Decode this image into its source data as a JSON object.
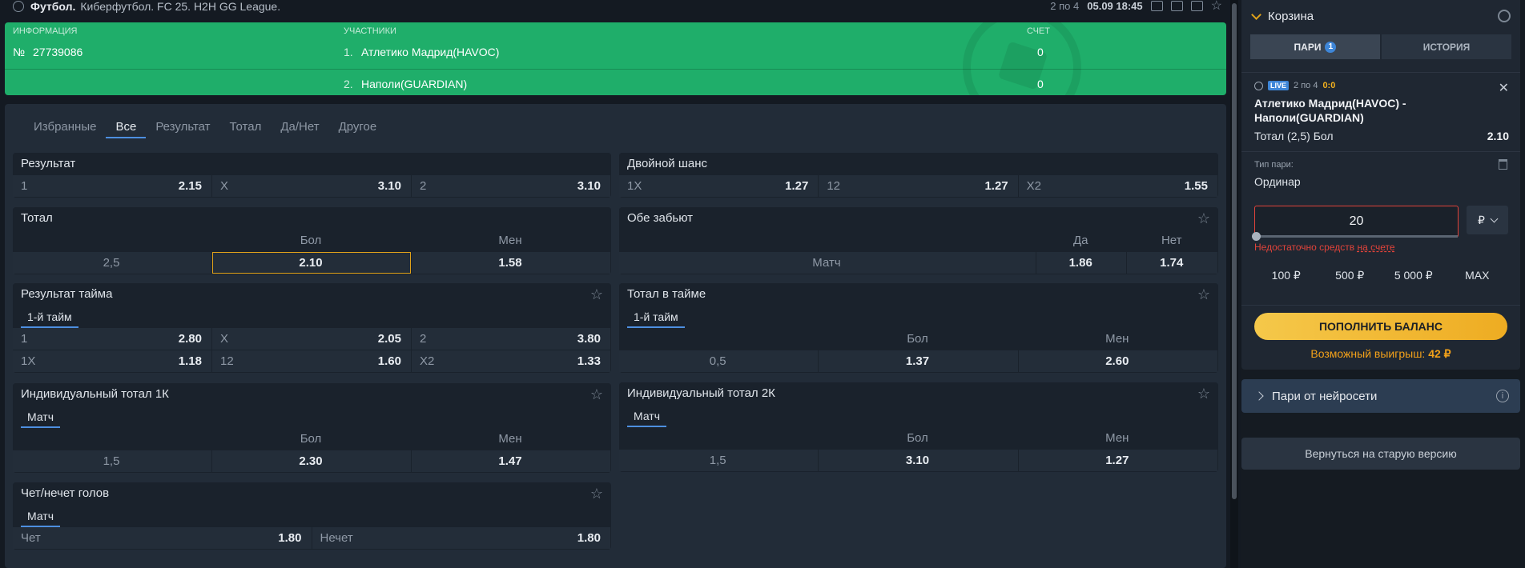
{
  "topbar": {
    "sport": "Футбол.",
    "league": "Киберфутбол. FC 25. H2H GG League.",
    "period": "2 по 4",
    "datetime": "05.09 18:45"
  },
  "scoreboard": {
    "info_label": "ИНФОРМАЦИЯ",
    "participants_label": "УЧАСТНИКИ",
    "score_label": "СЧЕТ",
    "number_sign": "№",
    "match_id": "27739086",
    "teams": [
      {
        "num": "1.",
        "name": "Атлетико Мадрид(HAVOC)",
        "score": "0"
      },
      {
        "num": "2.",
        "name": "Наполи(GUARDIAN)",
        "score": "0"
      }
    ]
  },
  "tabs": [
    "Избранные",
    "Все",
    "Результат",
    "Тотал",
    "Да/Нет",
    "Другое"
  ],
  "markets": {
    "result": {
      "title": "Результат",
      "cells": [
        [
          "1",
          "2.15"
        ],
        [
          "X",
          "3.10"
        ],
        [
          "2",
          "3.10"
        ]
      ]
    },
    "double": {
      "title": "Двойной шанс",
      "cells": [
        [
          "1X",
          "1.27"
        ],
        [
          "12",
          "1.27"
        ],
        [
          "X2",
          "1.55"
        ]
      ]
    },
    "total": {
      "title": "Тотал",
      "head": [
        "Бол",
        "Мен"
      ],
      "line": "2,5",
      "over": "2.10",
      "under": "1.58"
    },
    "both": {
      "title": "Обе забьют",
      "head": [
        "Да",
        "Нет"
      ],
      "label": "Матч",
      "yes": "1.86",
      "no": "1.74"
    },
    "half_result": {
      "title": "Результат тайма",
      "subtab": "1-й тайм",
      "rows": [
        [
          [
            "1",
            "2.80"
          ],
          [
            "X",
            "2.05"
          ],
          [
            "2",
            "3.80"
          ]
        ],
        [
          [
            "1X",
            "1.18"
          ],
          [
            "12",
            "1.60"
          ],
          [
            "X2",
            "1.33"
          ]
        ]
      ]
    },
    "half_total": {
      "title": "Тотал в тайме",
      "subtab": "1-й тайм",
      "head": [
        "Бол",
        "Мен"
      ],
      "line": "0,5",
      "over": "1.37",
      "under": "2.60"
    },
    "ind1": {
      "title": "Индивидуальный тотал 1К",
      "subtab": "Матч",
      "head": [
        "Бол",
        "Мен"
      ],
      "line": "1,5",
      "over": "2.30",
      "under": "1.47"
    },
    "ind2": {
      "title": "Индивидуальный тотал 2К",
      "subtab": "Матч",
      "head": [
        "Бол",
        "Мен"
      ],
      "line": "1,5",
      "over": "3.10",
      "under": "1.27"
    },
    "oddeven": {
      "title": "Чет/нечет голов",
      "subtab": "Матч",
      "cells": [
        [
          "Чет",
          "1.80"
        ],
        [
          "Нечет",
          "1.80"
        ]
      ]
    }
  },
  "cart": {
    "title": "Корзина",
    "tab_bets": "ПАРИ",
    "tab_bets_count": "1",
    "tab_history": "ИСТОРИЯ",
    "live": "LIVE",
    "period": "2 по 4",
    "score": "0:0",
    "event": "Атлетико Мадрид(HAVOC) - Наполи(GUARDIAN)",
    "pick": "Тотал (2,5) Бол",
    "odd": "2.10",
    "type_label": "Тип пари:",
    "type_value": "Ординар",
    "stake": "20",
    "currency": "₽",
    "error_text": "Недостаточно средств ",
    "error_link": "на счете",
    "quick": [
      "100 ₽",
      "500 ₽",
      "5 000 ₽",
      "MAX"
    ],
    "topup": "ПОПОЛНИТЬ БАЛАНС",
    "win_label": "Возможный выигрыш: ",
    "win_value": "42 ₽"
  },
  "ai_bets": "Пари от нейросети",
  "old_version": "Вернуться на старую версию",
  "colors": {
    "accent_green": "#1fae6a",
    "accent_yellow": "#eeac22",
    "error": "#e0433a",
    "link_blue": "#4d8fe0"
  }
}
